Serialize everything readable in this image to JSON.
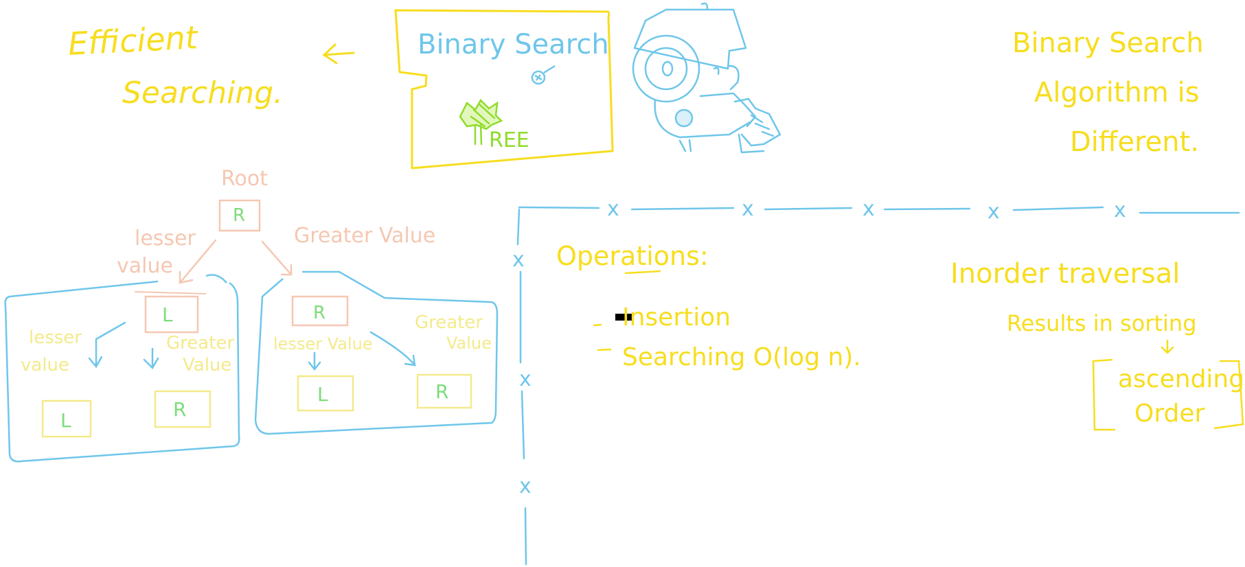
{
  "colors": {
    "yellow": "#f7dd1e",
    "blue": "#6ec6ea",
    "peach": "#f5c7b2",
    "green": "#7ddc7a",
    "lime": "#8fdc2a",
    "pale_yellow": "#f3ea8a"
  },
  "heading": {
    "efficient": "Efficient",
    "searching": "Searching."
  },
  "title_box": {
    "title": "Binary Search",
    "tree_label": "REE"
  },
  "note_right": {
    "line1": "Binary Search",
    "line2": "Algorithm is",
    "line3": "Different."
  },
  "tree": {
    "root_label": "Root",
    "root_node": "R",
    "left_edge_label_1": "lesser",
    "left_edge_label_2": "value",
    "right_edge_label": "Greater Value",
    "left_subtree": {
      "node": "L",
      "lesser_1": "lesser",
      "lesser_2": "value",
      "greater_1": "Greater",
      "greater_2": "Value",
      "left_leaf": "L",
      "right_leaf": "R"
    },
    "right_subtree": {
      "node": "R",
      "lesser": "lesser Value",
      "greater_1": "Greater",
      "greater_2": "Value",
      "left_leaf": "L",
      "right_leaf": "R"
    }
  },
  "operations": {
    "title": "Operations:",
    "item1": "Insertion",
    "item2": "Searching  O(log n)."
  },
  "inorder": {
    "title": "Inorder traversal",
    "line1": "Results in sorting",
    "result_1": "ascending",
    "result_2": "Order"
  },
  "grid_marks": {
    "mark": "x"
  }
}
